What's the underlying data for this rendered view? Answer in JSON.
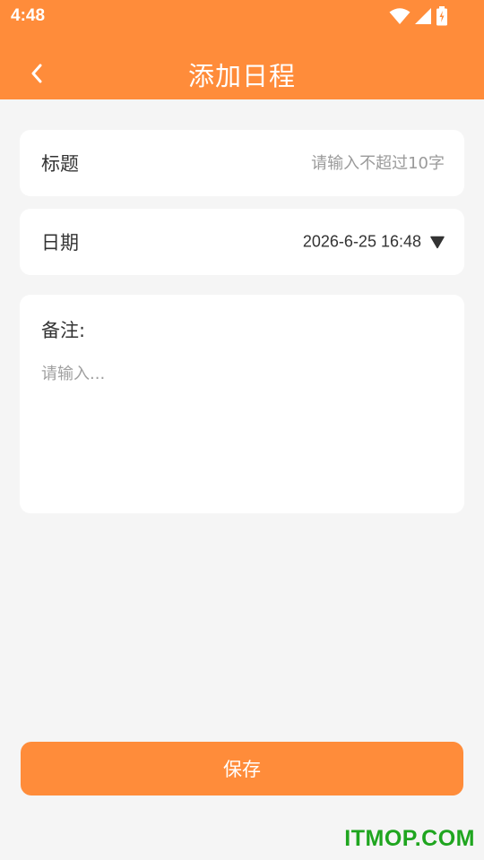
{
  "status_bar": {
    "time": "4:48",
    "icons": [
      "wifi-icon",
      "cellular-signal-icon",
      "battery-charging-icon"
    ]
  },
  "toolbar": {
    "title": "添加日程",
    "back_icon": "chevron-left-icon"
  },
  "form": {
    "title_field": {
      "label": "标题",
      "value": "",
      "placeholder": "请输入不超过10字"
    },
    "date_field": {
      "label": "日期",
      "value": "2026-6-25 16:48",
      "icon": "caret-down-icon"
    },
    "note_field": {
      "label": "备注:",
      "value": "",
      "placeholder": "请输入..."
    }
  },
  "save_button": {
    "label": "保存"
  },
  "watermark": {
    "text": "ITMOP.COM"
  },
  "colors": {
    "accent": "#ff8c3a",
    "background": "#f5f5f5",
    "card": "#ffffff",
    "watermark": "#1fa51f"
  }
}
